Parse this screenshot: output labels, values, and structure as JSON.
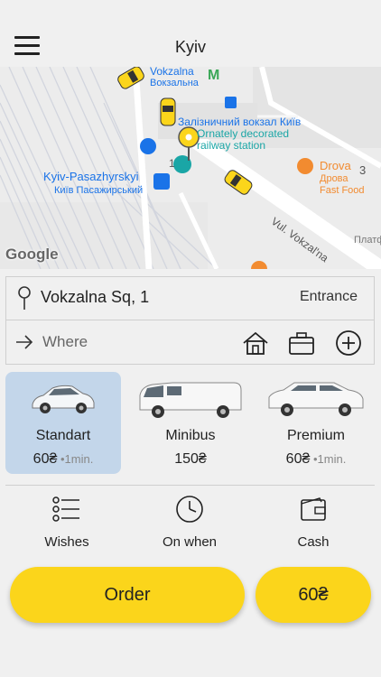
{
  "header": {
    "city": "Kyiv"
  },
  "map": {
    "labels": {
      "vokzalna_metro_en": "Vokzalna",
      "vokzalna_metro_ua": "Вокзальна",
      "railway_station": "Залізничний вокзал Київ",
      "decorated_1": "Ornately decorated",
      "decorated_2": "railway station",
      "pasazhyrskyi_en": "Kyiv-Pasazhyrskyi",
      "pasazhyrskyi_ua": "Київ Пасажирський",
      "drova_en": "Drova",
      "drova_ua": "Дрова",
      "drova_type": "Fast Food",
      "street": "Vul. Vokzal'na",
      "platform": "Платф",
      "num_1": "1",
      "num_3": "3"
    },
    "attribution": "Google",
    "colors": {
      "taxi": "#fbd51b",
      "poi_blue": "#1a73e8",
      "poi_orange": "#f28b30",
      "poi_teal": "#1aa6a6",
      "metro": "#3aa757"
    }
  },
  "route": {
    "from_address": "Vokzalna Sq, 1",
    "entrance_label": "Entrance",
    "to_placeholder": "Where"
  },
  "icons": {
    "menu": "hamburger-icon",
    "pin": "map-pin-icon",
    "arrow": "arrow-right-icon",
    "home": "home-icon",
    "work": "briefcase-icon",
    "add": "plus-circle-icon"
  },
  "tariffs": [
    {
      "name": "Standart",
      "price": "60₴",
      "eta": " •1min.",
      "selected": true
    },
    {
      "name": "Minibus",
      "price": "150₴",
      "eta": "",
      "selected": false
    },
    {
      "name": "Premium",
      "price": "60₴",
      "eta": " •1min.",
      "selected": false
    }
  ],
  "options": [
    {
      "label": "Wishes",
      "icon": "list-icon"
    },
    {
      "label": "On when",
      "icon": "clock-icon"
    },
    {
      "label": "Cash",
      "icon": "wallet-icon"
    }
  ],
  "actions": {
    "order_label": "Order",
    "total_price": "60₴"
  },
  "colors": {
    "accent": "#fbd51b",
    "selected_bg": "#c3d6ea",
    "background": "#f0f0f0"
  }
}
